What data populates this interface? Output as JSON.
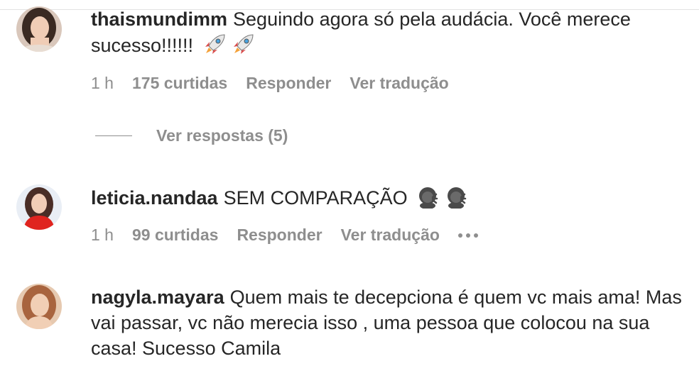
{
  "comments": [
    {
      "username": "thaismundimm",
      "text": "Seguindo agora só pela audácia. Você merece sucesso!!!!!!",
      "emoji": [
        "rocket-icon",
        "rocket-icon"
      ],
      "time": "1 h",
      "likes": "175 curtidas",
      "reply": "Responder",
      "translate": "Ver tradução"
    },
    {
      "username": "leticia.nandaa",
      "text": "SEM COMPARAÇÃO",
      "emoji": [
        "face-blowing-icon",
        "face-blowing-icon"
      ],
      "time": "1 h",
      "likes": "99 curtidas",
      "reply": "Responder",
      "translate": "Ver tradução"
    },
    {
      "username": "nagyla.mayara",
      "text": "Quem mais te decepciona é quem vc mais ama! Mas vai passar, vc não merecia isso , uma pessoa que colocou na sua casa! Sucesso Camila"
    }
  ],
  "replies_toggle": "Ver respostas (5)",
  "colors": {
    "text": "#262626",
    "secondary": "#8e8e8e",
    "divider": "#e3e3e3"
  }
}
